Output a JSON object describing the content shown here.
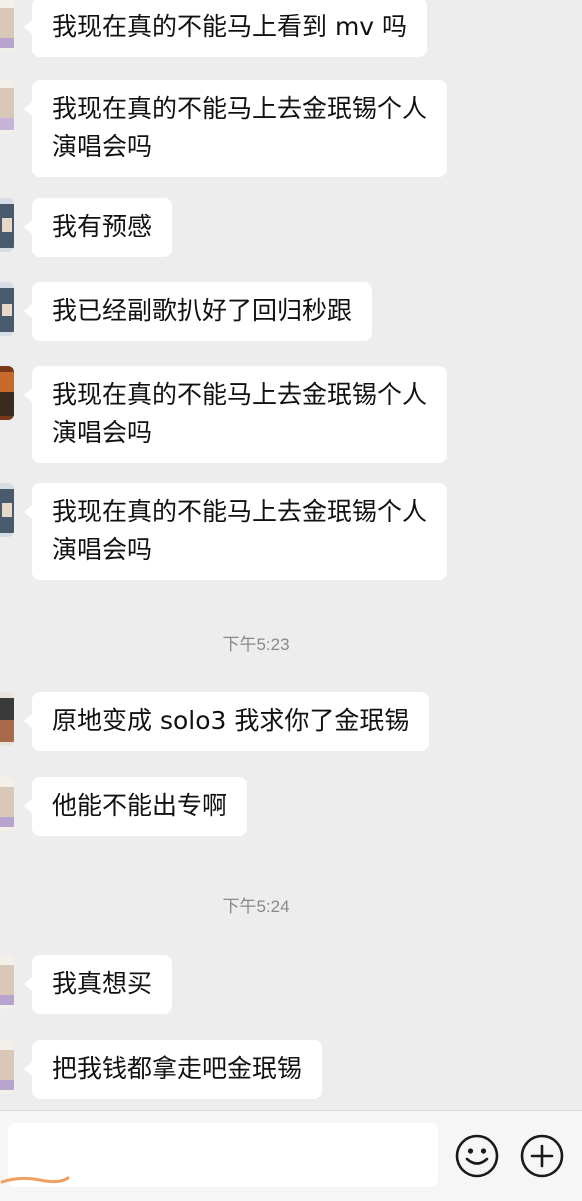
{
  "messages": [
    {
      "text": "我现在真的不能马上看到 mv 吗",
      "avatar": "avatar-a"
    },
    {
      "text": "我现在真的不能马上去金珉锡个人\n演唱会吗",
      "avatar": "avatar-a"
    },
    {
      "text": "我有预感",
      "avatar": "avatar-b"
    },
    {
      "text": "我已经副歌扒好了回归秒跟",
      "avatar": "avatar-b"
    },
    {
      "text": "我现在真的不能马上去金珉锡个人\n演唱会吗",
      "avatar": "avatar-c"
    },
    {
      "text": "我现在真的不能马上去金珉锡个人\n演唱会吗",
      "avatar": "avatar-b"
    },
    {
      "text": "原地变成 solo3 我求你了金珉锡",
      "avatar": "avatar-d"
    },
    {
      "text": "他能不能出专啊",
      "avatar": "avatar-a"
    },
    {
      "text": "我真想买",
      "avatar": "avatar-a"
    },
    {
      "text": "把我钱都拿走吧金珉锡",
      "avatar": "avatar-a"
    }
  ],
  "timestamps": [
    "下午5:23",
    "下午5:24"
  ],
  "input": {
    "value": "",
    "placeholder": ""
  },
  "icons": {
    "emoji": "smiley-face-icon",
    "more": "plus-circle-icon"
  },
  "colors": {
    "background": "#ededed",
    "bubble": "#ffffff",
    "text": "#111111",
    "timestamp": "#8a8a8a",
    "scribble": "#f0a060"
  }
}
